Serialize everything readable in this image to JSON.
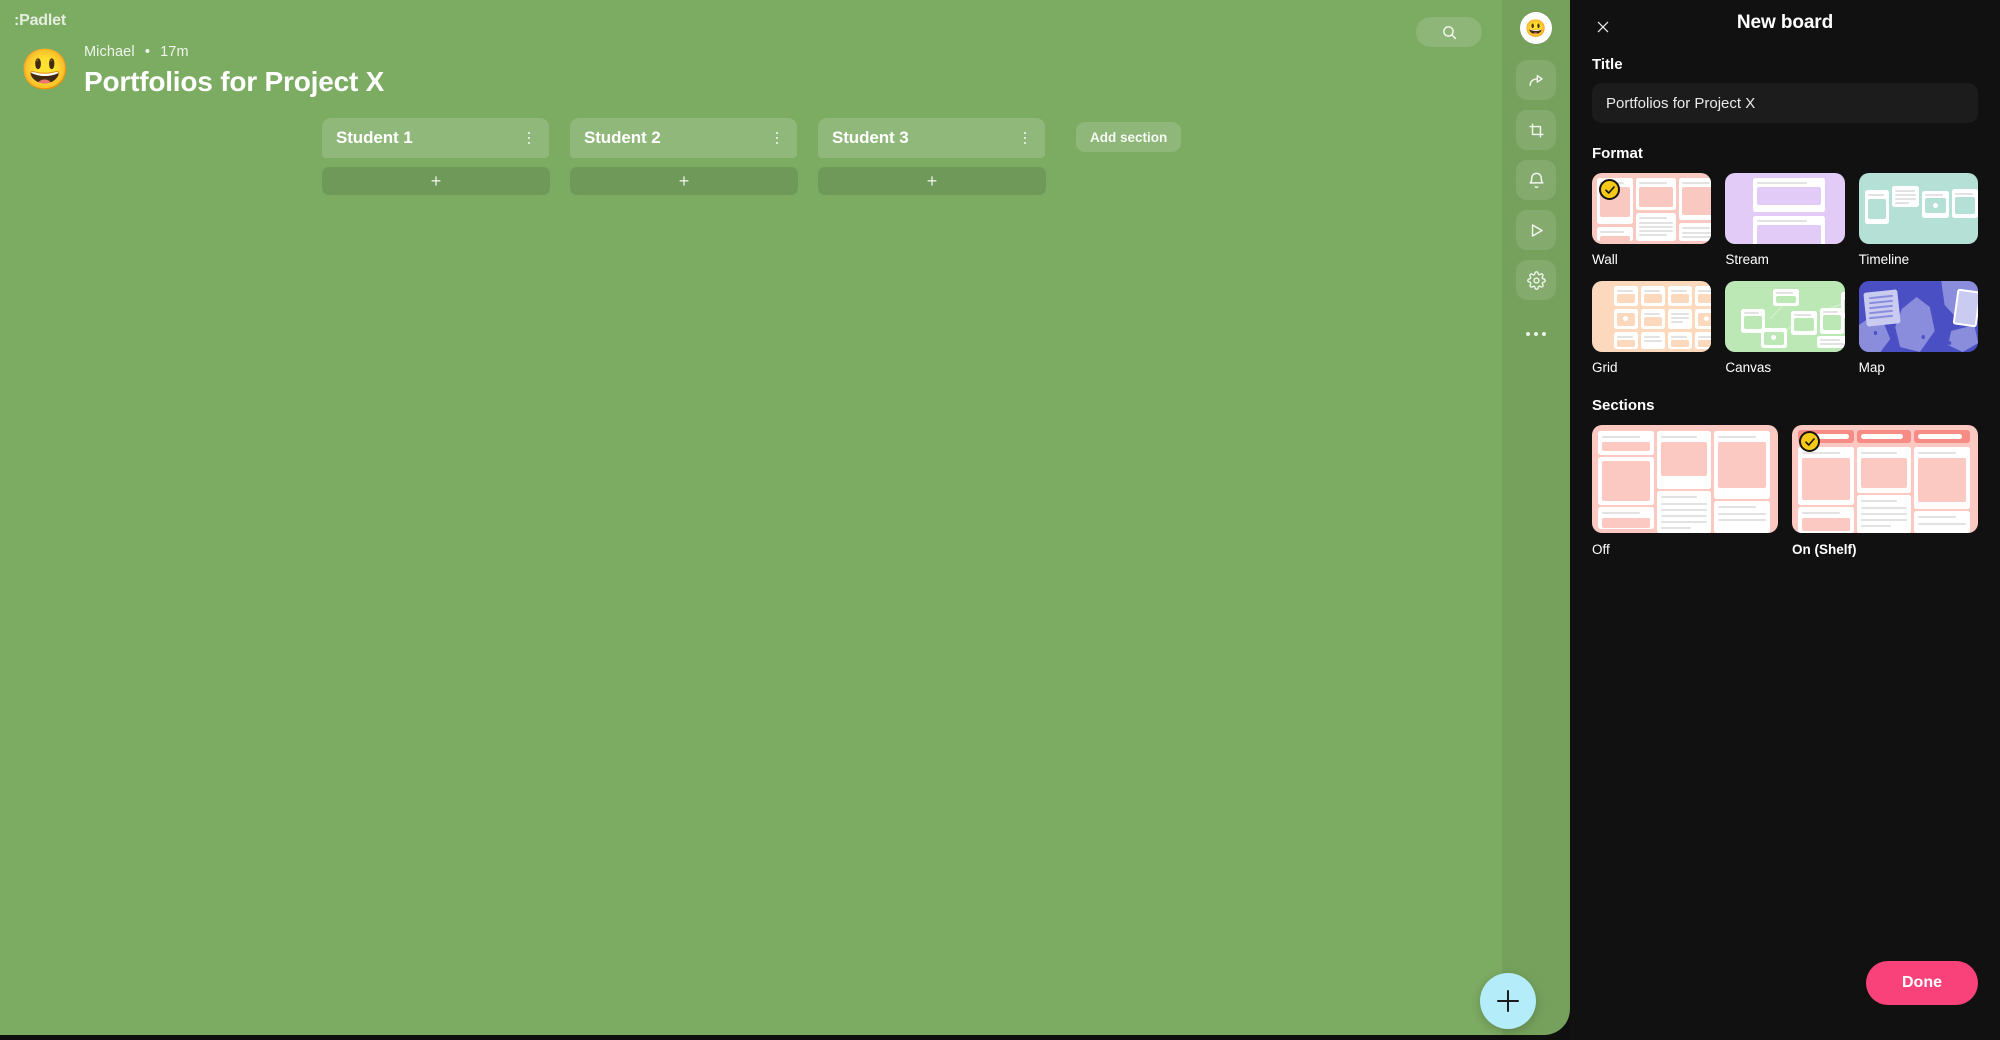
{
  "app": {
    "logo_text": ":Padlet",
    "background_color": "#7cab62"
  },
  "board": {
    "author": "Michael",
    "separator": "•",
    "time_ago": "17m",
    "title": "Portfolios for Project X",
    "avatar_emoji": "😃",
    "search_icon": "search-icon",
    "add_post_label": "+",
    "add_section_label": "Add section",
    "fab_label": "+",
    "sections": [
      {
        "name": "Student 1"
      },
      {
        "name": "Student 2"
      },
      {
        "name": "Student 3"
      }
    ]
  },
  "rail": {
    "avatar_emoji": "😃",
    "items": [
      {
        "name": "share-icon"
      },
      {
        "name": "remix-icon"
      },
      {
        "name": "bell-icon"
      },
      {
        "name": "play-icon"
      },
      {
        "name": "gear-icon"
      },
      {
        "name": "more-icon"
      }
    ]
  },
  "panel": {
    "title": "New board",
    "close_icon": "close-icon",
    "title_field": {
      "label": "Title",
      "value": "Portfolios for Project X",
      "placeholder": "Title"
    },
    "format": {
      "label": "Format",
      "selected": "Wall",
      "options": [
        {
          "label": "Wall",
          "color": "#f9c8c0",
          "selected": true
        },
        {
          "label": "Stream",
          "color": "#e2ccf7",
          "selected": false
        },
        {
          "label": "Timeline",
          "color": "#b4e0d6",
          "selected": false
        },
        {
          "label": "Grid",
          "color": "#fcd8bd",
          "selected": false
        },
        {
          "label": "Canvas",
          "color": "#bbe8b4",
          "selected": false
        },
        {
          "label": "Map",
          "color": "#4b4fc4",
          "selected": false
        }
      ]
    },
    "sections": {
      "label": "Sections",
      "selected": "On (Shelf)",
      "options": [
        {
          "label": "Off",
          "color": "#fbc8c2",
          "selected": false
        },
        {
          "label": "On (Shelf)",
          "color": "#fbc8c2",
          "selected": true
        }
      ]
    },
    "done_label": "Done",
    "accent_color": "#f9417a",
    "check_color": "#f6c916"
  }
}
